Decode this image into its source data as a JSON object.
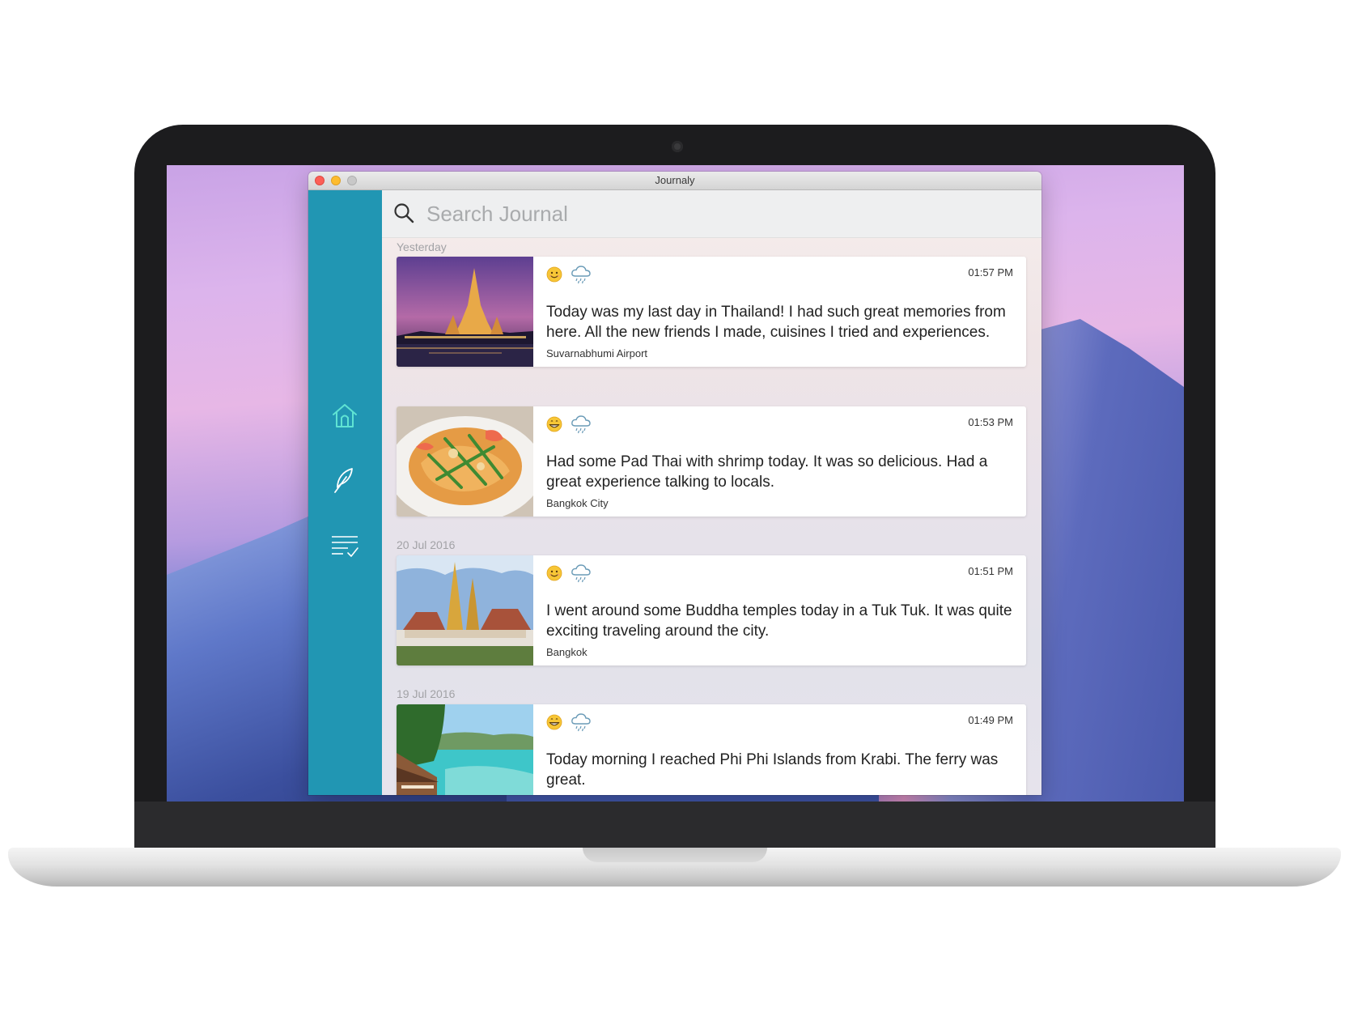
{
  "window": {
    "title": "Journaly"
  },
  "search": {
    "placeholder": "Search Journal",
    "value": ""
  },
  "sidebar": {
    "items": [
      {
        "name": "home",
        "icon": "home-icon"
      },
      {
        "name": "write",
        "icon": "feather-icon"
      },
      {
        "name": "tasks",
        "icon": "checklist-icon"
      }
    ],
    "accent_color": "#2196b3"
  },
  "groups": [
    {
      "date": "Yesterday",
      "entries": [
        {
          "time": "01:57 PM",
          "mood": "smiling-face",
          "weather": "rain-cloud",
          "text": "Today was my last day in Thailand! I had such great memories from here. All the new friends I made, cuisines I tried and experiences.",
          "location": "Suvarnabhumi Airport",
          "image": "temple-at-night"
        },
        {
          "time": "01:53 PM",
          "mood": "grinning-face",
          "weather": "rain-cloud",
          "text": "Had some Pad Thai with shrimp today. It was so delicious. Had a great experience talking to locals.",
          "location": "Bangkok City",
          "image": "pad-thai"
        }
      ]
    },
    {
      "date": "20 Jul 2016",
      "entries": [
        {
          "time": "01:51 PM",
          "mood": "smiling-face",
          "weather": "rain-cloud",
          "text": "I went around some Buddha temples today in a Tuk Tuk. It was quite exciting traveling around the city.",
          "location": "Bangkok",
          "image": "buddha-temple"
        }
      ]
    },
    {
      "date": "19 Jul 2016",
      "entries": [
        {
          "time": "01:49 PM",
          "mood": "grinning-face",
          "weather": "rain-cloud",
          "text": "Today morning I reached Phi Phi Islands from Krabi. The ferry was great.",
          "location": "",
          "image": "beach-resort"
        }
      ]
    }
  ]
}
